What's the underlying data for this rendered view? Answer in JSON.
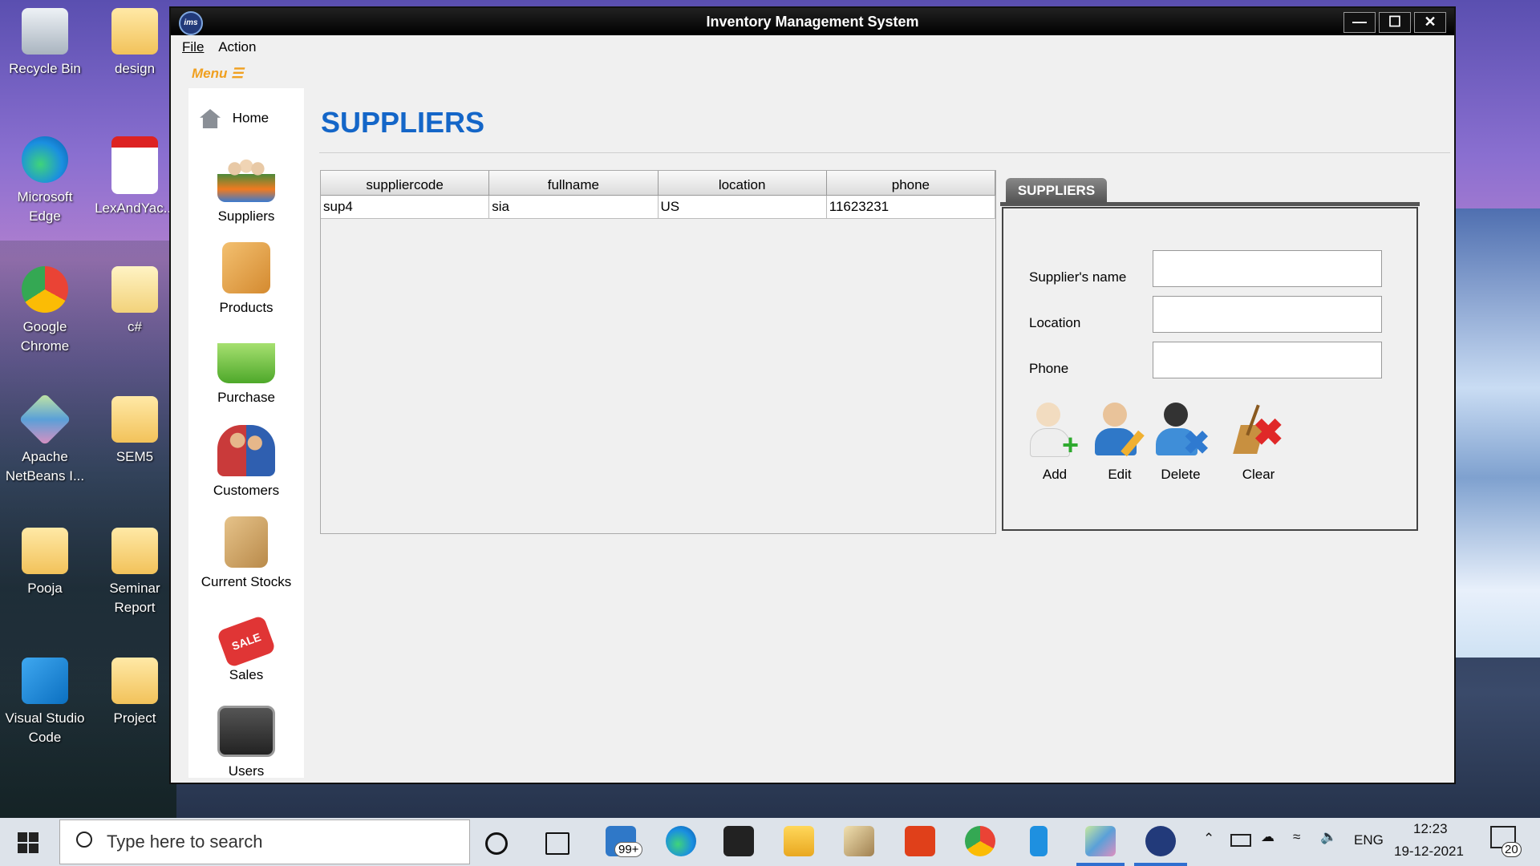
{
  "desktop": {
    "icons": [
      {
        "label": "Recycle Bin"
      },
      {
        "label": "design"
      },
      {
        "label": "Microsoft Edge"
      },
      {
        "label": "LexAndYac..."
      },
      {
        "label": "Google Chrome"
      },
      {
        "label": "c#"
      },
      {
        "label": "Apache NetBeans I..."
      },
      {
        "label": "SEM5"
      },
      {
        "label": "Pooja"
      },
      {
        "label": "Seminar Report"
      },
      {
        "label": "Visual Studio Code"
      },
      {
        "label": "Project"
      }
    ]
  },
  "window": {
    "title": "Inventory Management System",
    "app_icon": "ims",
    "menus": [
      "File",
      "Action"
    ],
    "menu_toggle": "Menu ☰"
  },
  "sidebar": {
    "items": [
      {
        "label": "Home",
        "icon": "home-icon"
      },
      {
        "label": "Suppliers",
        "icon": "suppliers-icon"
      },
      {
        "label": "Products",
        "icon": "products-icon"
      },
      {
        "label": "Purchase",
        "icon": "purchase-icon"
      },
      {
        "label": "Customers",
        "icon": "customers-icon"
      },
      {
        "label": "Current Stocks",
        "icon": "stocks-icon"
      },
      {
        "label": "Sales",
        "icon": "sales-icon"
      },
      {
        "label": "Users",
        "icon": "users-icon"
      }
    ]
  },
  "main": {
    "title": "SUPPLIERS",
    "table": {
      "columns": [
        "suppliercode",
        "fullname",
        "location",
        "phone"
      ],
      "rows": [
        [
          "sup4",
          "sia",
          "US",
          "11623231"
        ]
      ]
    },
    "panel": {
      "tab": "SUPPLIERS",
      "fields": [
        {
          "label": "Supplier's name",
          "value": ""
        },
        {
          "label": "Location",
          "value": ""
        },
        {
          "label": "Phone",
          "value": ""
        }
      ],
      "actions": [
        {
          "label": "Add",
          "icon": "add-user-icon"
        },
        {
          "label": "Edit",
          "icon": "edit-user-icon"
        },
        {
          "label": "Delete",
          "icon": "delete-user-icon"
        },
        {
          "label": "Clear",
          "icon": "clear-broom-icon"
        }
      ]
    }
  },
  "taskbar": {
    "search_placeholder": "Type here to search",
    "mail_badge": "99+",
    "language": "ENG",
    "time": "12:23",
    "date": "19-12-2021",
    "notifications": "20"
  }
}
